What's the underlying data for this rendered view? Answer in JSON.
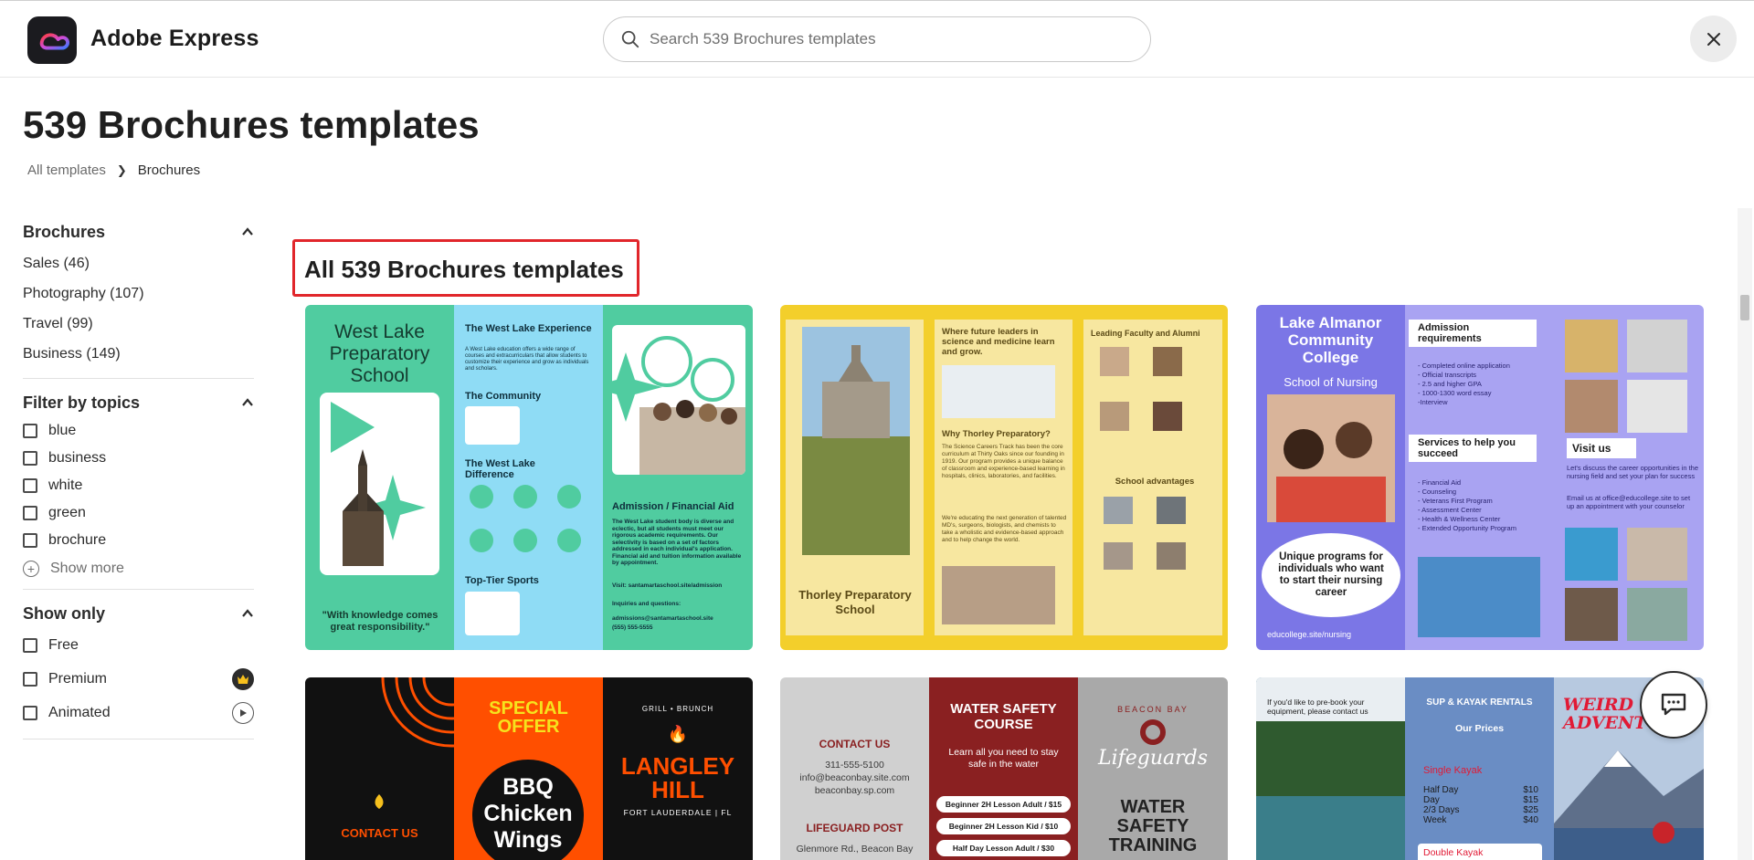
{
  "header": {
    "brand": "Adobe Express",
    "search_placeholder": "Search 539 Brochures templates"
  },
  "page": {
    "title": "539 Brochures templates",
    "breadcrumb": [
      "All templates",
      "Brochures"
    ]
  },
  "sidebar": {
    "categories_title": "Brochures",
    "categories": [
      "Sales (46)",
      "Photography (107)",
      "Travel (99)",
      "Business (149)"
    ],
    "topics_title": "Filter by topics",
    "topics": [
      "blue",
      "business",
      "white",
      "green",
      "brochure"
    ],
    "show_more": "Show more",
    "show_only_title": "Show only",
    "show_only": [
      "Free",
      "Premium",
      "Animated"
    ]
  },
  "main": {
    "section_label": "All 539 Brochures templates"
  },
  "templates": {
    "westlake": {
      "school": "West Lake Preparatory School",
      "quote": "\"With knowledge comes great responsibility.\"",
      "experience_head": "The West Lake Experience",
      "experience_body": "A West Lake education offers a wide range of courses and extracurriculars that allow students to customize their experience and grow as individuals and scholars.",
      "community_head": "The Community",
      "difference_head": "The West Lake Difference",
      "sports_head": "Top-Tier Sports",
      "admission_head": "Admission / Financial Aid",
      "admission_body": "The West Lake student body is diverse and eclectic, but all students must meet our rigorous academic requirements. Our selectivity is based on a set of factors addressed in each individual's application. Financial aid and tuition information available by appointment.",
      "visit": "Visit: santamartaschool.site/admission",
      "inquiries": "Inquiries and questions:",
      "email": "admissions@santamartaschool.site",
      "phone": "(555) 555-5555"
    },
    "thorley": {
      "name": "Thorley Preparatory School",
      "future_head": "Where future leaders in science and medicine learn and grow.",
      "why_head": "Why Thorley Preparatory?",
      "why_body": "The Science Careers Track has been the core curriculum at Thirty Oaks since our founding in 1919. Our program provides a unique balance of classroom and experience-based learning in hospitals, clinics, laboratories, and facilities.",
      "educating": "We're educating the next generation of talented MD's, surgeons, biologists, and chemists to take a wholistic and evidence-based approach and to help change the world.",
      "faculty_head": "Leading Faculty and Alumni",
      "advantages_head": "School advantages"
    },
    "almanor": {
      "college": "Lake Almanor Community College",
      "school": "School of Nursing",
      "bubble": "Unique programs for individuals who want to start their nursing career",
      "url": "educollege.site/nursing",
      "adm_head": "Admission requirements",
      "adm_items": [
        "- Completed online application",
        "- Official transcripts",
        "- 2.5 and higher GPA",
        "- 1000-1300 word essay",
        "-Interview"
      ],
      "services_head": "Services to help you succeed",
      "services_items": [
        "- Financial Aid",
        "- Counseling",
        "- Veterans First Program",
        "- Assessment Center",
        "- Health & Wellness Center",
        "- Extended Opportunity Program"
      ],
      "visit_head": "Visit us",
      "visit_body": "Let's discuss the career opportunities in the nursing field and set your plan for success",
      "visit_email": "Email us at office@educollege.site to set up an appointment with your counselor"
    },
    "langley": {
      "contact": "CONTACT US",
      "special": "SPECIAL OFFER",
      "bbq": "BBQ Chicken Wings",
      "grill": "GRILL • BRUNCH",
      "name": "LANGLEY HILL",
      "location": "FORT LAUDERDALE | FL"
    },
    "beacon": {
      "contact": "CONTACT US",
      "phone": "311-555-5100",
      "email": "info@beaconbay.site.com",
      "site": "beaconbay.sp.com",
      "post": "LIFEGUARD POST",
      "address": "Glenmore Rd., Beacon Bay",
      "course_head": "WATER SAFETY COURSE",
      "course_body": "Learn all you need to stay safe in the water",
      "lesson1": "Beginner 2H Lesson Adult / $15",
      "lesson2": "Beginner 2H Lesson Kid / $10",
      "lesson3": "Half Day Lesson Adult / $30",
      "arc": "BEACON BAY",
      "script": "Lifeguards",
      "training": "WATER SAFETY TRAINING"
    },
    "kayak": {
      "prebook": "If you'd like to pre-book your equipment, please contact us",
      "rentals": "SUP & KAYAK RENTALS",
      "prices": "Our Prices",
      "single": "Single Kayak",
      "rows": [
        [
          "Half Day",
          "$10"
        ],
        [
          "Day",
          "$15"
        ],
        [
          "2/3 Days",
          "$25"
        ],
        [
          "Week",
          "$40"
        ]
      ],
      "double": "Double Kayak",
      "weird": "WEIRD ADVENTU"
    }
  },
  "colors": {
    "accent_red": "#e1262b",
    "mint": "#50cca0",
    "sky": "#8fdcf5",
    "yellow": "#f3cf2b",
    "lavender": "#8d87ea",
    "orange": "#ff4f00",
    "maroon": "#8a2021"
  }
}
